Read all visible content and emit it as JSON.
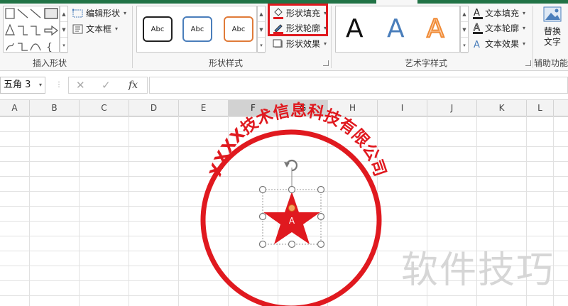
{
  "ribbon": {
    "insert_shapes": {
      "group_label": "插入形状",
      "edit_shape": "编辑形状",
      "text_box": "文本框"
    },
    "shape_styles": {
      "group_label": "形状样式",
      "presets": [
        "Abc",
        "Abc",
        "Abc"
      ],
      "shape_fill": "形状填充",
      "shape_outline": "形状轮廓",
      "shape_effects": "形状效果"
    },
    "wordart_styles": {
      "group_label": "艺术字样式",
      "samples": [
        "A",
        "A",
        "A"
      ],
      "text_fill": "文本填充",
      "text_outline": "文本轮廓",
      "text_effects": "文本效果"
    },
    "accessibility": {
      "group_label": "辅助功能",
      "replace_text_line1": "替换",
      "replace_text_line2": "文字"
    }
  },
  "formula_bar": {
    "name_box": "五角 3",
    "fx_label": "fx",
    "formula": ""
  },
  "columns": [
    "A",
    "B",
    "C",
    "D",
    "E",
    "F",
    "G",
    "H",
    "I",
    "J",
    "K",
    "L"
  ],
  "selected_columns": [
    "F",
    "G"
  ],
  "stamp": {
    "arc_text": "XXXX技术信息科技有限公司",
    "star_label": "A",
    "color": "#e0191f"
  },
  "watermark": "软件技巧",
  "colors": {
    "excel_green": "#217346",
    "highlight_red": "#e0191f",
    "preset1_border": "#222222",
    "preset2_border": "#4a7ebb",
    "preset3_border": "#e07b39",
    "wordart_black": "#111111",
    "wordart_blue": "#4a7ebb",
    "wordart_orange": "#f08a35"
  }
}
